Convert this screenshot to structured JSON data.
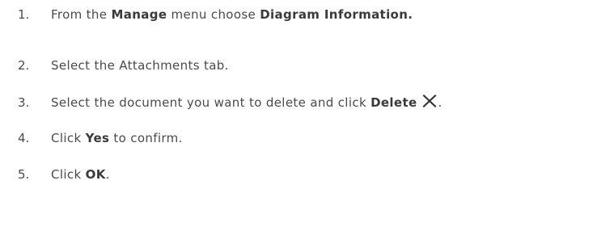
{
  "steps": [
    {
      "number": "1.",
      "parts": [
        "From the ",
        "Manage",
        " menu choose ",
        "Diagram Information."
      ]
    },
    {
      "number": "2.",
      "parts": [
        "Select the Attachments tab."
      ]
    },
    {
      "number": "3.",
      "parts": [
        "Select the document you want to delete and click ",
        "Delete",
        "."
      ],
      "icon": "delete-x-icon"
    },
    {
      "number": "4.",
      "parts": [
        "Click ",
        "Yes",
        " to confirm."
      ]
    },
    {
      "number": "5.",
      "parts": [
        "Click ",
        "OK",
        "."
      ]
    }
  ]
}
